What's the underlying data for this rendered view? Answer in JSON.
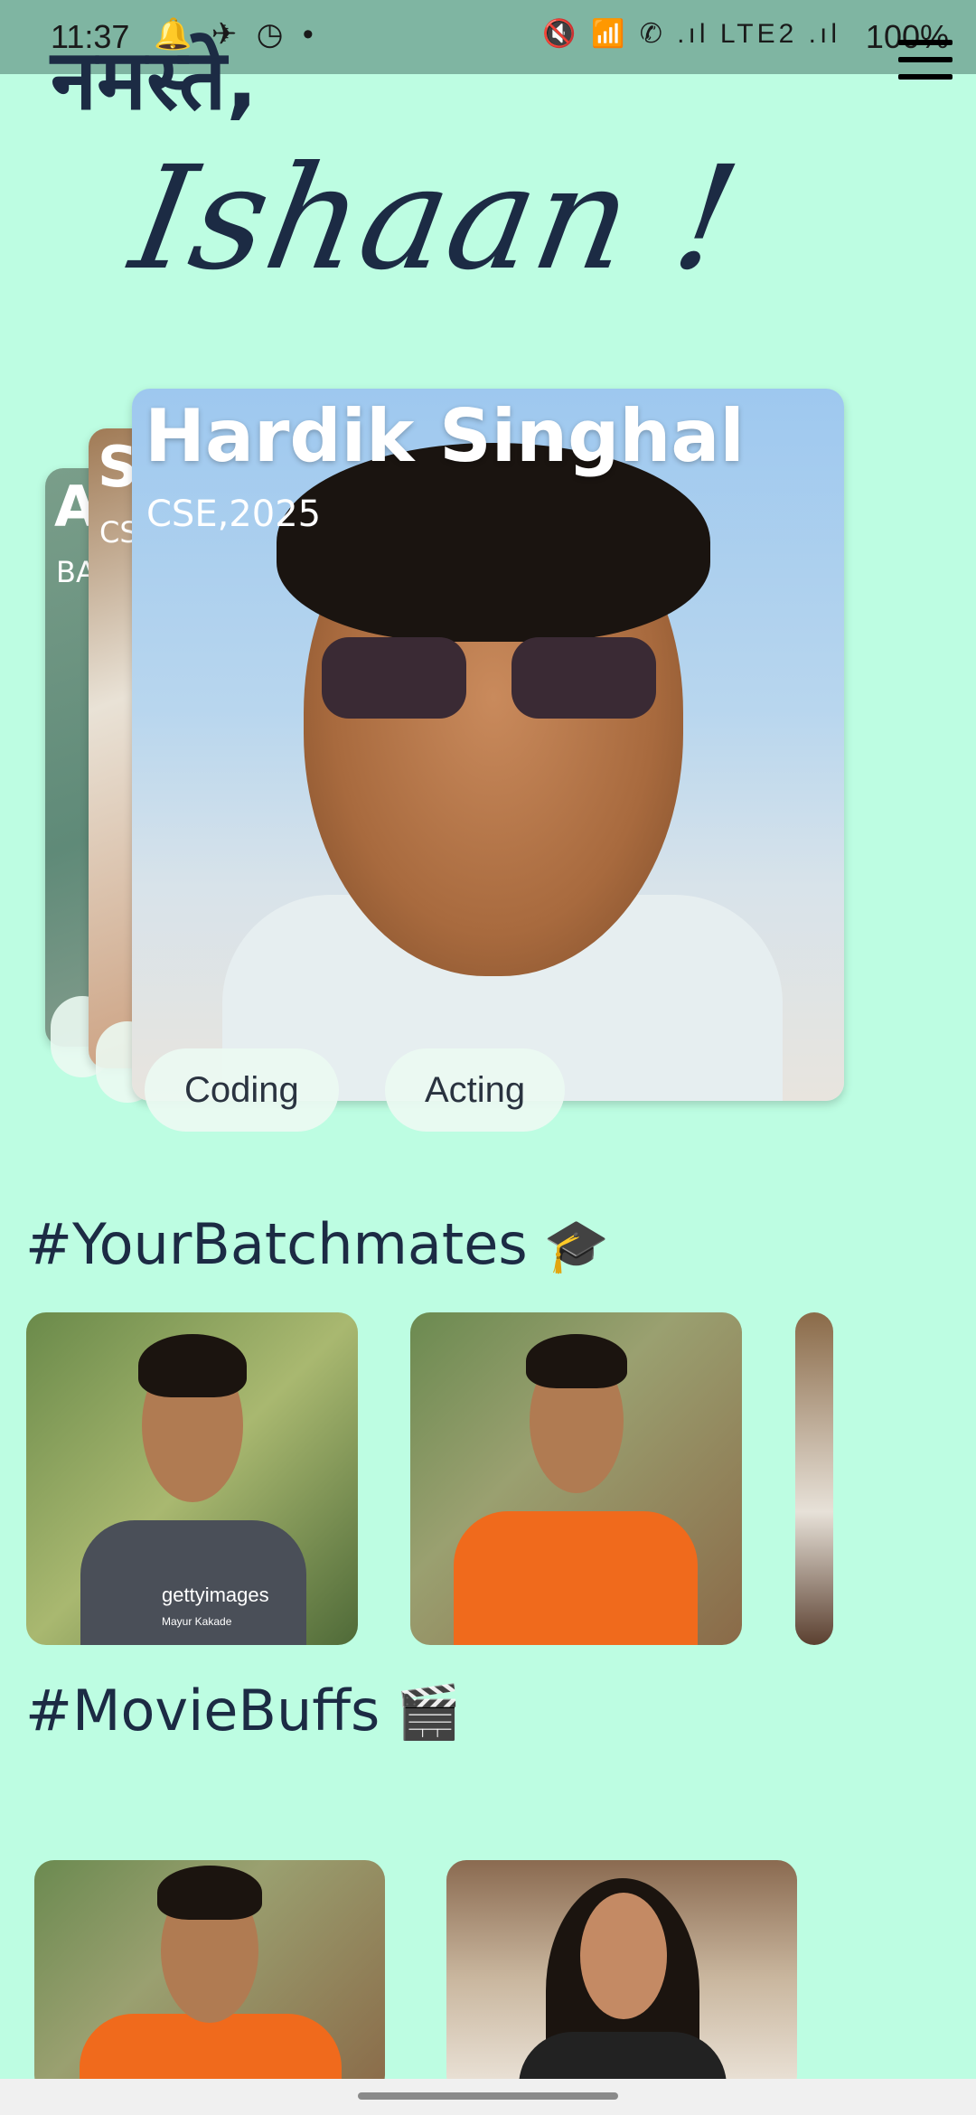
{
  "status_bar": {
    "time": "11:37",
    "left_icons": "🔔 ✈ ◷ •",
    "right_icons": "🔇 📶 ✆ .ıl LTE2 .ıl",
    "battery": "100%"
  },
  "greeting": {
    "hello": "नमस्ते,",
    "name": "Ishaan !"
  },
  "profile_stack": {
    "front": {
      "name": "Hardik Singhal",
      "subtitle": "CSE,2025",
      "interests": [
        "Coding",
        "Acting"
      ]
    },
    "back1": {
      "name_initial": "S",
      "subtitle_partial": "CS"
    },
    "back2": {
      "name_initial": "A",
      "subtitle_partial": "BA"
    }
  },
  "sections": {
    "batchmates": {
      "title": "#YourBatchmates",
      "emoji": "🎓"
    },
    "moviebuffs": {
      "title": "#MovieBuffs",
      "emoji": "🎬"
    }
  },
  "thumb_watermark": "gettyimages",
  "thumb_credit": "Mayur Kakade",
  "colors": {
    "background": "#bdfde2",
    "text": "#1c2b44",
    "status_bar": "#7fb5a2"
  }
}
